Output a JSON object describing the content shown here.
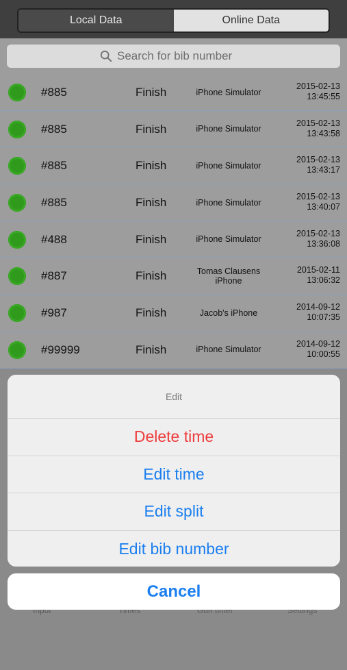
{
  "segment": {
    "local": "Local Data",
    "online": "Online Data"
  },
  "search": {
    "placeholder": "Search for bib number"
  },
  "rows": [
    {
      "bib": "#885",
      "kind": "Finish",
      "device_l1": "iPhone Simulator",
      "device_l2": "",
      "date": "2015-02-13",
      "time": "13:45:55"
    },
    {
      "bib": "#885",
      "kind": "Finish",
      "device_l1": "iPhone Simulator",
      "device_l2": "",
      "date": "2015-02-13",
      "time": "13:43:58"
    },
    {
      "bib": "#885",
      "kind": "Finish",
      "device_l1": "iPhone Simulator",
      "device_l2": "",
      "date": "2015-02-13",
      "time": "13:43:17"
    },
    {
      "bib": "#885",
      "kind": "Finish",
      "device_l1": "iPhone Simulator",
      "device_l2": "",
      "date": "2015-02-13",
      "time": "13:40:07"
    },
    {
      "bib": "#488",
      "kind": "Finish",
      "device_l1": "iPhone Simulator",
      "device_l2": "",
      "date": "2015-02-13",
      "time": "13:36:08"
    },
    {
      "bib": "#887",
      "kind": "Finish",
      "device_l1": "Tomas Clausens",
      "device_l2": "iPhone",
      "date": "2015-02-11",
      "time": "13:06:32"
    },
    {
      "bib": "#987",
      "kind": "Finish",
      "device_l1": "Jacob's iPhone",
      "device_l2": "",
      "date": "2014-09-12",
      "time": "10:07:35"
    },
    {
      "bib": "#99999",
      "kind": "Finish",
      "device_l1": "iPhone Simulator",
      "device_l2": "",
      "date": "2014-09-12",
      "time": "10:00:55"
    }
  ],
  "sheet": {
    "title": "Edit",
    "delete_label": "Delete time",
    "edit_time_label": "Edit time",
    "edit_split_label": "Edit split",
    "edit_bib_label": "Edit bib number",
    "cancel_label": "Cancel"
  },
  "tabs": {
    "input": "Input",
    "times": "Times",
    "gun": "Gun timer",
    "settings": "Settings"
  },
  "colors": {
    "accent": "#1b7ff0",
    "destructive": "#ee3c3c",
    "status_dot": "#2f9a1c"
  },
  "icons": {
    "search": "magnifier-icon"
  }
}
